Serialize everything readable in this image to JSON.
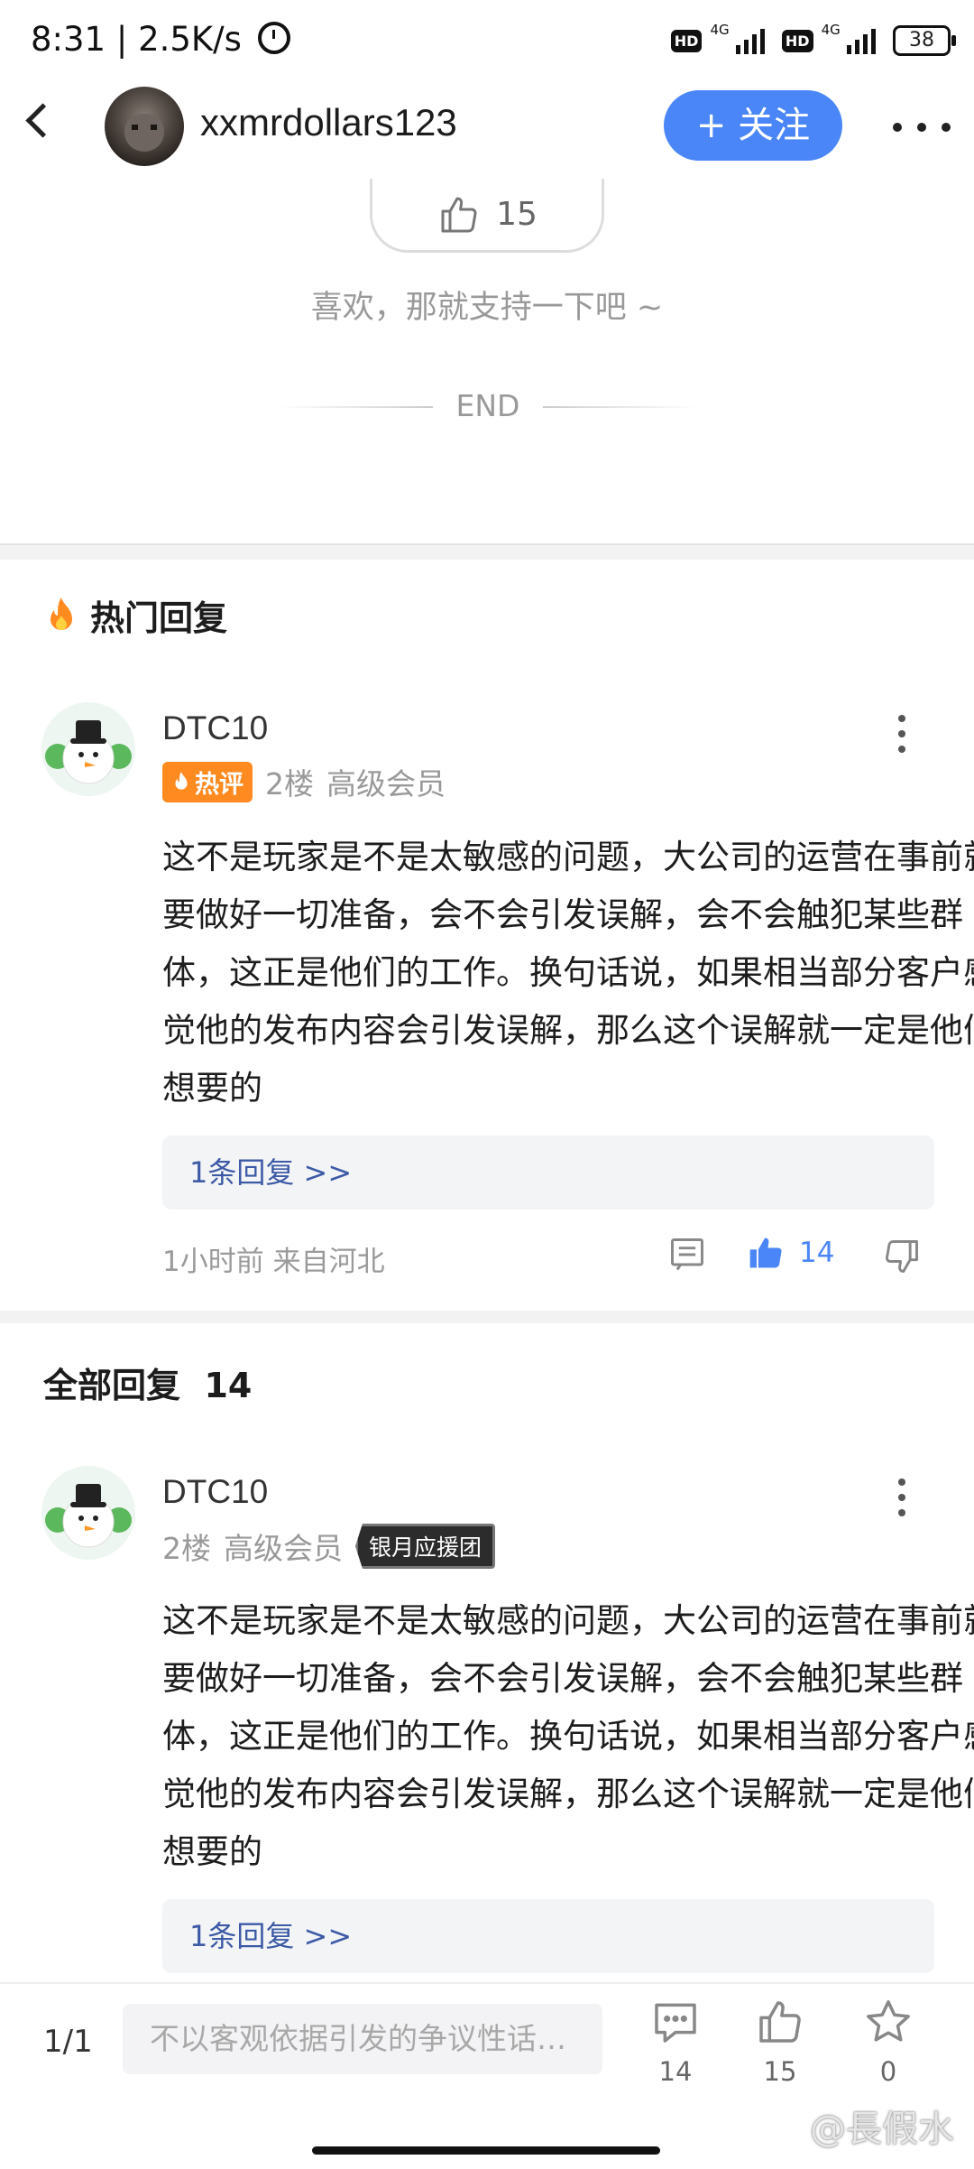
{
  "status_bar": {
    "time_speed": "8:31 | 2.5K/s",
    "hd1": "HD",
    "net1": "4G",
    "hd2": "HD",
    "net2": "4G",
    "battery": "38"
  },
  "header": {
    "username": "xxmrdollars123",
    "follow_label": "+ 关注"
  },
  "post_footer": {
    "like_count": "15",
    "support_text": "喜欢，那就支持一下吧 ~",
    "end_label": "END"
  },
  "hot_section": {
    "title": "热门回复",
    "comment": {
      "author": "DTC10",
      "badge": "热评",
      "floor": "2楼",
      "level": "高级会员",
      "body": "这不是玩家是不是太敏感的问题，大公司的运营在事前就要做好一切准备，会不会引发误解，会不会触犯某些群体，这正是他们的工作。换句话说，如果相当部分客户感觉他的发布内容会引发误解，那么这个误解就一定是他们想要的",
      "reply_link": "1条回复 >>",
      "time_location": "1小时前 来自河北",
      "likes": "14"
    }
  },
  "all_section": {
    "title": "全部回复",
    "count": "14",
    "comment": {
      "author": "DTC10",
      "floor": "2楼",
      "level": "高级会员",
      "group_badge": "银月应援团",
      "body": "这不是玩家是不是太敏感的问题，大公司的运营在事前就要做好一切准备，会不会引发误解，会不会触犯某些群体，这正是他们的工作。换句话说，如果相当部分客户感觉他的发布内容会引发误解，那么这个误解就一定是他们想要的",
      "reply_link": "1条回复 >>"
    }
  },
  "bottom_bar": {
    "page": "1/1",
    "input_placeholder": "不以客观依据引发的争议性话…",
    "comments": "14",
    "likes": "15",
    "favorites": "0"
  },
  "watermark": "@長假水",
  "colors": {
    "accent": "#4a86f7",
    "hot_badge": "#ff8a20",
    "link": "#3c5aa6"
  }
}
